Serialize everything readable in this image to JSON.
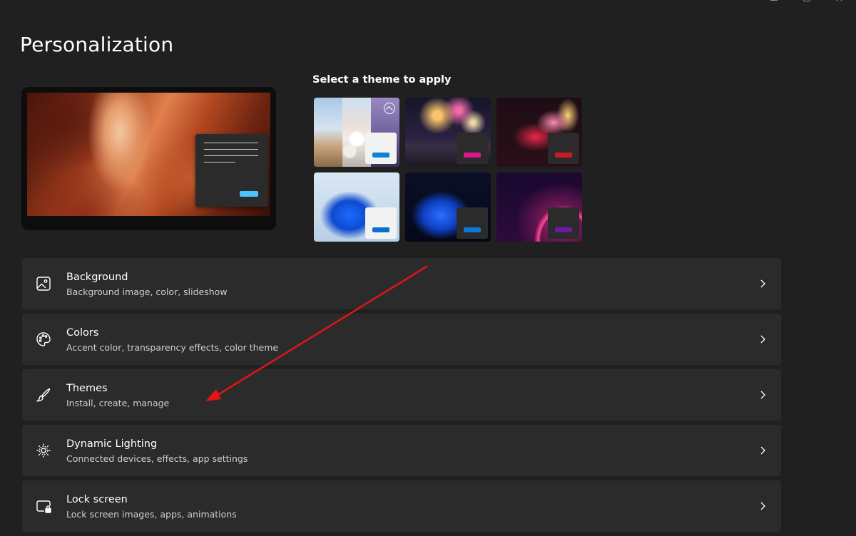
{
  "page": {
    "title": "Personalization"
  },
  "themes": {
    "heading": "Select a theme to apply",
    "tiles": [
      {
        "name": "glow-photos",
        "accent": "#0a84d8",
        "mini_bg": "#f2f2f2"
      },
      {
        "name": "fireworks",
        "accent": "#e0168e",
        "mini_bg": "#2b2b2b"
      },
      {
        "name": "flower-dark",
        "accent": "#d01820",
        "mini_bg": "#2b2b2b"
      },
      {
        "name": "windows-light",
        "accent": "#0a6fd0",
        "mini_bg": "#f2f2f2"
      },
      {
        "name": "windows-dark",
        "accent": "#0a7ad8",
        "mini_bg": "#2b2b2b"
      },
      {
        "name": "glow-purple",
        "accent": "#6c1aa0",
        "mini_bg": "#2b2b2b"
      }
    ]
  },
  "settings": [
    {
      "id": "background",
      "title": "Background",
      "subtitle": "Background image, color, slideshow",
      "icon": "image-icon"
    },
    {
      "id": "colors",
      "title": "Colors",
      "subtitle": "Accent color, transparency effects, color theme",
      "icon": "palette-icon"
    },
    {
      "id": "themes",
      "title": "Themes",
      "subtitle": "Install, create, manage",
      "icon": "brush-icon"
    },
    {
      "id": "dynamic-lighting",
      "title": "Dynamic Lighting",
      "subtitle": "Connected devices, effects, app settings",
      "icon": "lighting-icon"
    },
    {
      "id": "lock-screen",
      "title": "Lock screen",
      "subtitle": "Lock screen images, apps, animations",
      "icon": "lock-screen-icon"
    }
  ],
  "colors": {
    "background": "#202020",
    "card": "#2b2b2b",
    "preview_accent": "#4cc2ff",
    "annotation_arrow": "#e01515"
  }
}
